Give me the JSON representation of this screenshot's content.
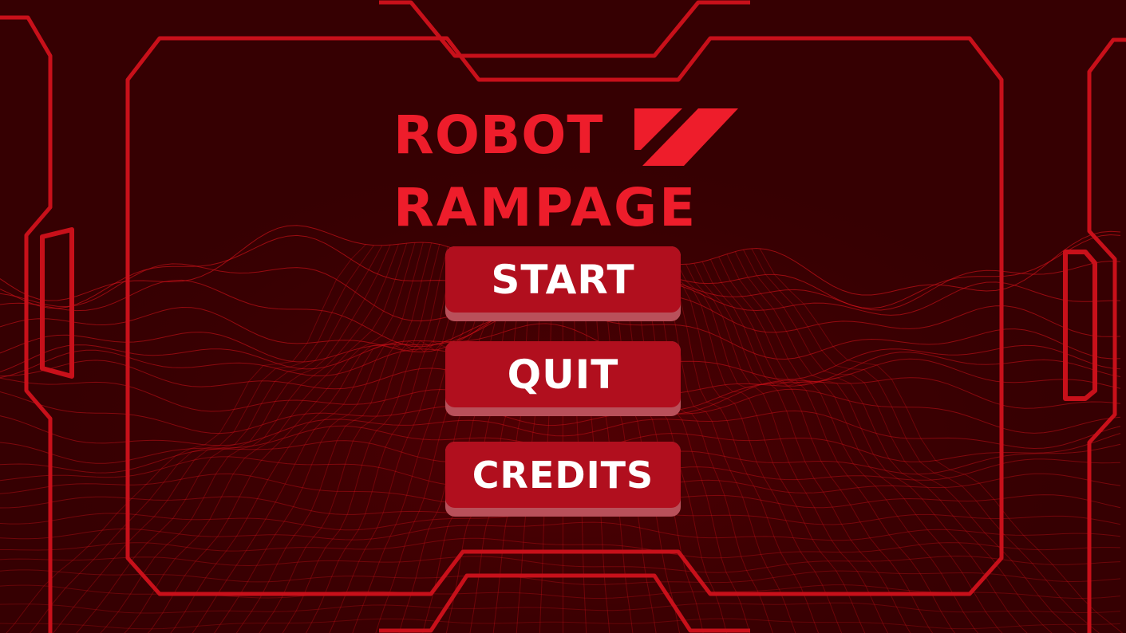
{
  "game": {
    "title_line1": "ROBOT",
    "title_line2": "RAMPAGE"
  },
  "menu": {
    "start_label": "START",
    "quit_label": "QUIT",
    "credits_label": "CREDITS"
  },
  "colors": {
    "background": "#3a0002",
    "accent": "#ee1d2b",
    "frame": "#c8101a",
    "button_face": "#b10f1e",
    "button_shadow": "#b9505a",
    "button_text": "#ffffff"
  }
}
